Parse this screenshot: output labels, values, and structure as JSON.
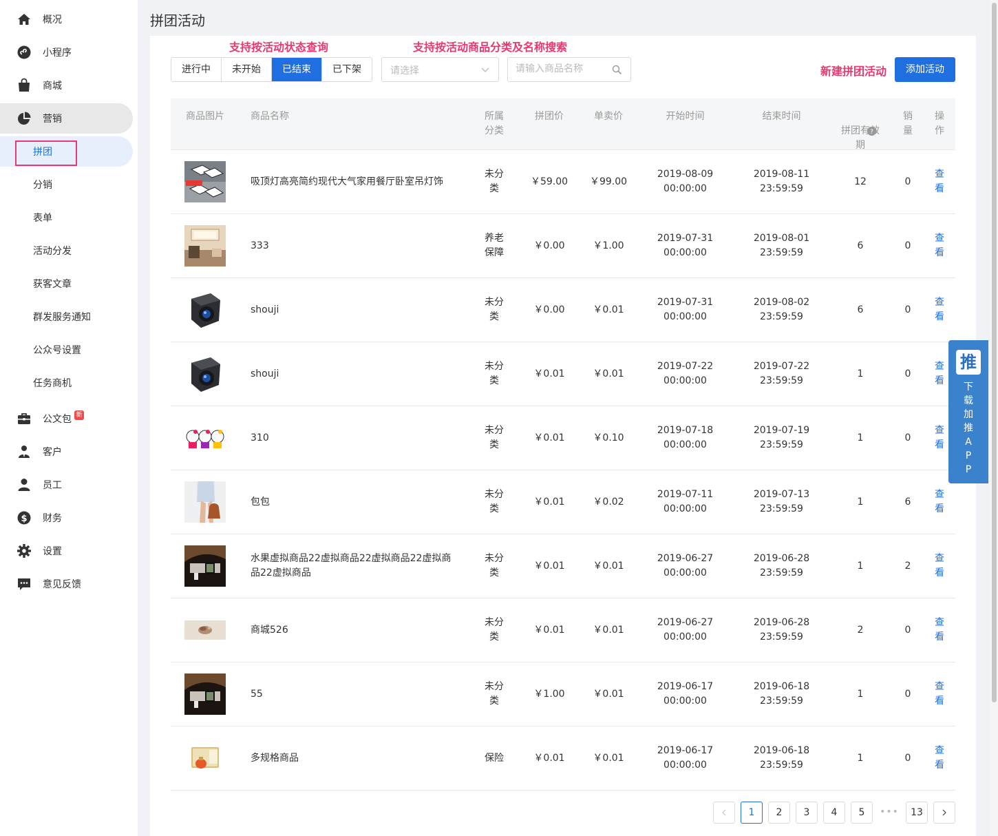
{
  "sidebar": {
    "items": [
      {
        "label": "概况",
        "icon": "home-icon"
      },
      {
        "label": "小程序",
        "icon": "miniprogram-icon"
      },
      {
        "label": "商城",
        "icon": "shopping-bag-icon"
      },
      {
        "label": "营销",
        "icon": "pie-chart-icon"
      },
      {
        "label": "公文包",
        "icon": "briefcase-icon",
        "badge": "新"
      },
      {
        "label": "客户",
        "icon": "customer-icon"
      },
      {
        "label": "员工",
        "icon": "user-icon"
      },
      {
        "label": "财务",
        "icon": "dollar-icon"
      },
      {
        "label": "设置",
        "icon": "gear-icon"
      },
      {
        "label": "意见反馈",
        "icon": "feedback-icon"
      }
    ],
    "marketing_sub": [
      "拼团",
      "分销",
      "表单",
      "活动分发",
      "获客文章",
      "群发服务通知",
      "公众号设置",
      "任务商机"
    ]
  },
  "page": {
    "title": "拼团活动"
  },
  "annotations": {
    "status": "支持按活动状态查询",
    "search": "支持按活动商品分类及名称搜索",
    "create": "新建拼团活动"
  },
  "filters": {
    "status_tabs": [
      "进行中",
      "未开始",
      "已结束",
      "已下架"
    ],
    "active_tab": "已结束",
    "category_placeholder": "请选择",
    "search_placeholder": "请输入商品名称"
  },
  "add_button": "添加活动",
  "table": {
    "headers": {
      "image": "商品图片",
      "name": "商品名称",
      "category": "所属\n分类",
      "group_price": "拼团价",
      "single_price": "单卖价",
      "start": "开始时间",
      "end": "结束时间",
      "validity": "拼团有效\n期",
      "sold": "销\n量",
      "op": "操\n作"
    },
    "rows": [
      {
        "name": "吸顶灯高亮简约现代大气家用餐厅卧室吊灯饰",
        "category": "未分\n类",
        "group_price": "￥59.00",
        "single_price": "￥99.00",
        "start": "2019-08-09\n00:00:00",
        "end": "2019-08-11\n23:59:59",
        "validity": "12",
        "sold": "0",
        "op": "查\n看",
        "img": "lamp"
      },
      {
        "name": "333",
        "category": "养老\n保障",
        "group_price": "￥0.00",
        "single_price": "￥1.00",
        "start": "2019-07-31\n00:00:00",
        "end": "2019-08-01\n23:59:59",
        "validity": "6",
        "sold": "0",
        "op": "查\n看",
        "img": "room"
      },
      {
        "name": "shouji",
        "category": "未分\n类",
        "group_price": "￥0.00",
        "single_price": "￥0.01",
        "start": "2019-07-31\n00:00:00",
        "end": "2019-08-02\n23:59:59",
        "validity": "6",
        "sold": "0",
        "op": "查\n看",
        "img": "camera"
      },
      {
        "name": "shouji",
        "category": "未分\n类",
        "group_price": "￥0.01",
        "single_price": "￥0.01",
        "start": "2019-07-22\n00:00:00",
        "end": "2019-07-22\n23:59:59",
        "validity": "1",
        "sold": "0",
        "op": "查\n看",
        "img": "camera"
      },
      {
        "name": "310",
        "category": "未分\n类",
        "group_price": "￥0.01",
        "single_price": "￥0.10",
        "start": "2019-07-18\n00:00:00",
        "end": "2019-07-19\n23:59:59",
        "validity": "1",
        "sold": "0",
        "op": "查\n看",
        "img": "kitty"
      },
      {
        "name": "包包",
        "category": "未分\n类",
        "group_price": "￥0.01",
        "single_price": "￥0.02",
        "start": "2019-07-11\n00:00:00",
        "end": "2019-07-13\n23:59:59",
        "validity": "1",
        "sold": "6",
        "op": "查\n看",
        "img": "bag"
      },
      {
        "name": "水果虚拟商品22虚拟商品22虚拟商品22虚拟商\n品22虚拟商品",
        "category": "未分\n类",
        "group_price": "￥0.01",
        "single_price": "￥0.01",
        "start": "2019-06-27\n00:00:00",
        "end": "2019-06-28\n23:59:59",
        "validity": "1",
        "sold": "2",
        "op": "查\n看",
        "img": "phone"
      },
      {
        "name": "商城526",
        "category": "未分\n类",
        "group_price": "￥0.01",
        "single_price": "￥0.01",
        "start": "2019-06-27\n00:00:00",
        "end": "2019-06-28\n23:59:59",
        "validity": "2",
        "sold": "0",
        "op": "查\n看",
        "img": "blur"
      },
      {
        "name": "55",
        "category": "未分\n类",
        "group_price": "￥1.00",
        "single_price": "￥0.01",
        "start": "2019-06-17\n00:00:00",
        "end": "2019-06-18\n23:59:59",
        "validity": "1",
        "sold": "0",
        "op": "查\n看",
        "img": "phone"
      },
      {
        "name": "多规格商品",
        "category": "保险",
        "group_price": "￥0.01",
        "single_price": "￥0.01",
        "start": "2019-06-17\n00:00:00",
        "end": "2019-06-18\n23:59:59",
        "validity": "1",
        "sold": "0",
        "op": "查\n看",
        "img": "perfume"
      }
    ]
  },
  "pagination": {
    "pages": [
      "1",
      "2",
      "3",
      "4",
      "5"
    ],
    "ellipsis": "•••",
    "last": "13",
    "current": "1"
  },
  "float_app": {
    "logo": "推",
    "text": "下\n载\n加\n推\nA\nP\nP"
  }
}
